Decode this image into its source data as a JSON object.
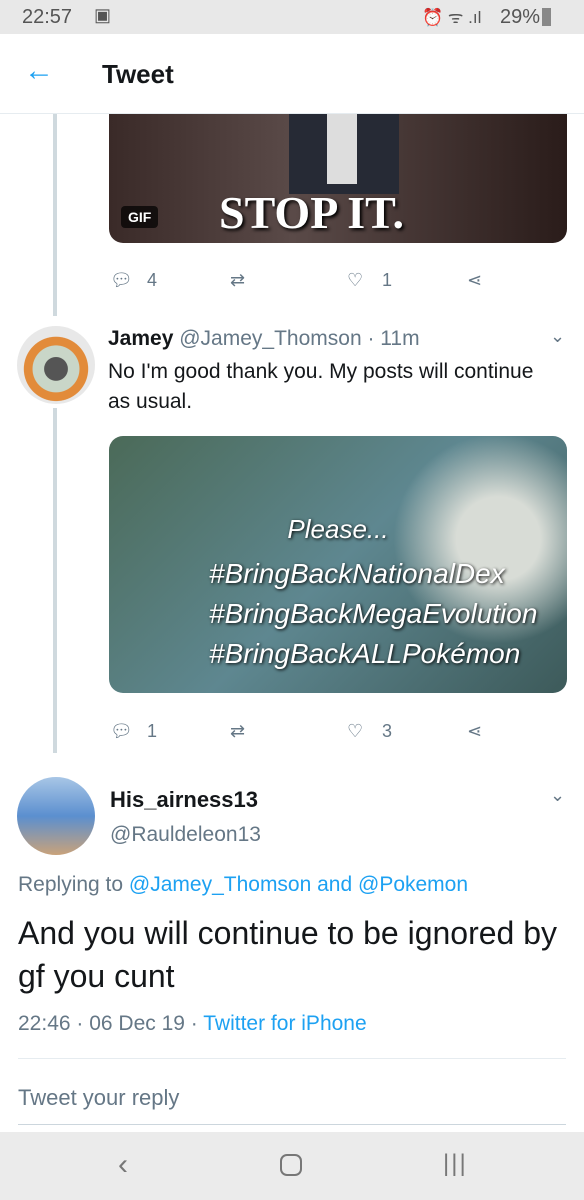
{
  "status_bar": {
    "time": "22:57",
    "battery": "29%"
  },
  "header": {
    "title": "Tweet"
  },
  "gif_tweet": {
    "gif_badge": "GIF",
    "caption": "STOP IT.",
    "replies": "4",
    "likes": "1"
  },
  "tweet2": {
    "name": "Jamey",
    "handle": "@Jamey_Thomson",
    "time": "· 11m",
    "text": "No I'm good thank you. My posts will continue as usual.",
    "image": {
      "title": "Please...",
      "lines": [
        "#BringBackNationalDex",
        "#BringBackMegaEvolution",
        "#BringBackALLPokémon"
      ]
    },
    "replies": "1",
    "likes": "3"
  },
  "main_tweet": {
    "name": "His_airness13",
    "handle": "@Rauldeleon13",
    "replying_prefix": "Replying to",
    "replying_to": "@Jamey_Thomson and @Pokemon",
    "text": "And you will continue to be ignored by gf you cunt",
    "date": "22:46 · 06 Dec 19 ·",
    "source": "Twitter for iPhone"
  },
  "reply_box": {
    "placeholder": "Tweet your reply"
  },
  "colors": {
    "accent": "#1da1f2"
  }
}
